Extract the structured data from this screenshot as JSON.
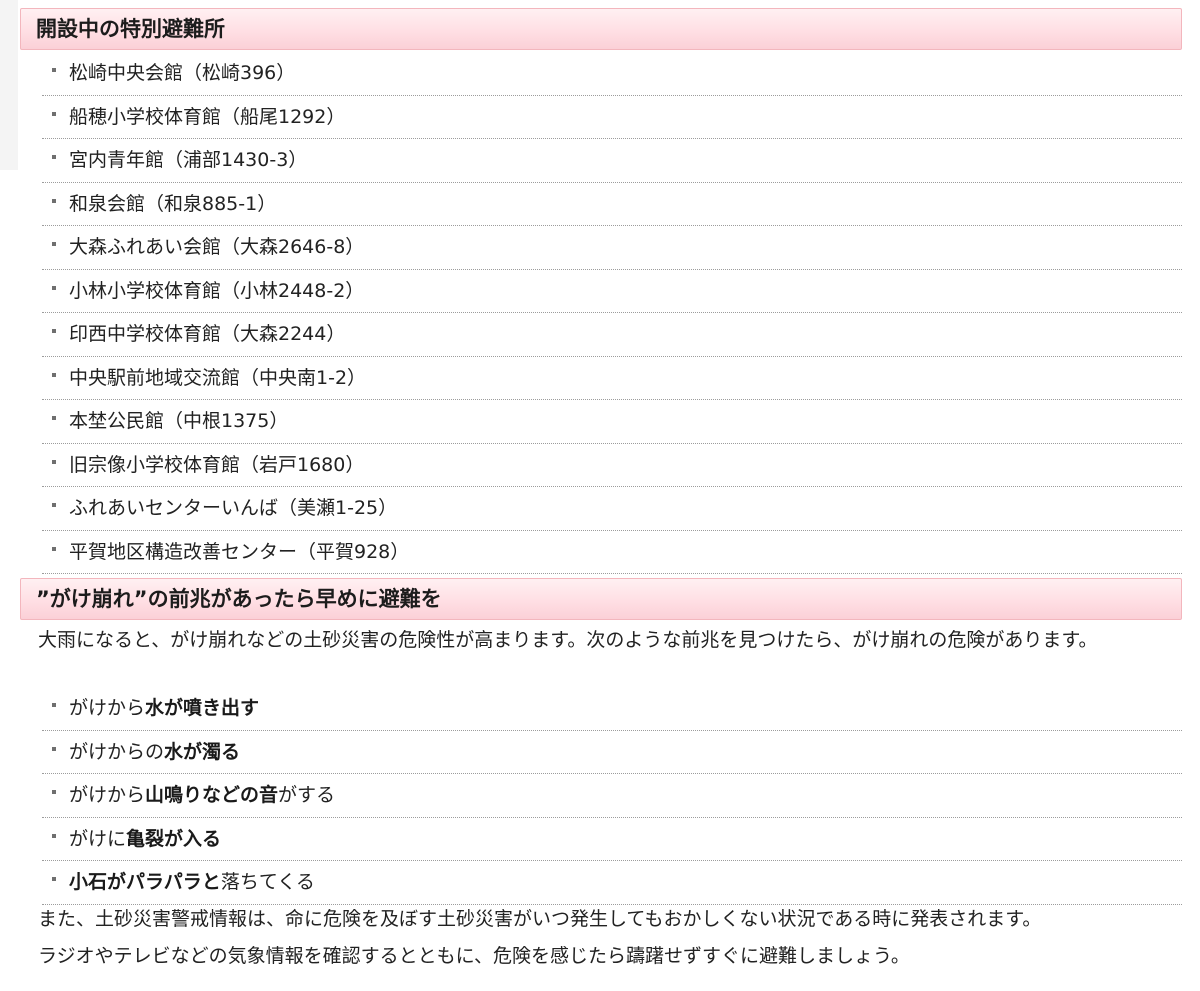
{
  "shelters": {
    "heading": "開設中の特別避難所",
    "items": [
      {
        "label": "松崎中央会館（松崎396）"
      },
      {
        "label": "船穂小学校体育館（船尾1292）"
      },
      {
        "label": "宮内青年館（浦部1430-3）"
      },
      {
        "label": "和泉会館（和泉885-1）"
      },
      {
        "label": "大森ふれあい会館（大森2646-8）"
      },
      {
        "label": "小林小学校体育館（小林2448-2）"
      },
      {
        "label": "印西中学校体育館（大森2244）"
      },
      {
        "label": "中央駅前地域交流館（中央南1-2）"
      },
      {
        "label": "本埜公民館（中根1375）"
      },
      {
        "label": "旧宗像小学校体育館（岩戸1680）"
      },
      {
        "label": "ふれあいセンターいんば（美瀬1-25）"
      },
      {
        "label": "平賀地区構造改善センター（平賀928）"
      }
    ]
  },
  "landslide": {
    "heading": "”がけ崩れ”の前兆があったら早めに避難を",
    "intro": "大雨になると、がけ崩れなどの土砂災害の危険性が高まります。次のような前兆を見つけたら、がけ崩れの危険があります。",
    "signs": [
      {
        "pre": "がけから",
        "bold": "水が噴き出す",
        "post": ""
      },
      {
        "pre": "がけからの",
        "bold": "水が濁る",
        "post": ""
      },
      {
        "pre": "がけから",
        "bold": "山鳴りなどの音",
        "post": "がする"
      },
      {
        "pre": "がけに",
        "bold": "亀裂が入る",
        "post": ""
      },
      {
        "pre": "",
        "bold": "小石がパラパラと",
        "post": "落ちてくる"
      }
    ],
    "closing_1": "また、土砂災害警戒情報は、命に危険を及ぼす土砂災害がいつ発生してもおかしくない状況である時に発表されます。",
    "closing_2": "ラジオやテレビなどの気象情報を確認するとともに、危険を感じたら躊躇せずすぐに避難しましょう。"
  }
}
